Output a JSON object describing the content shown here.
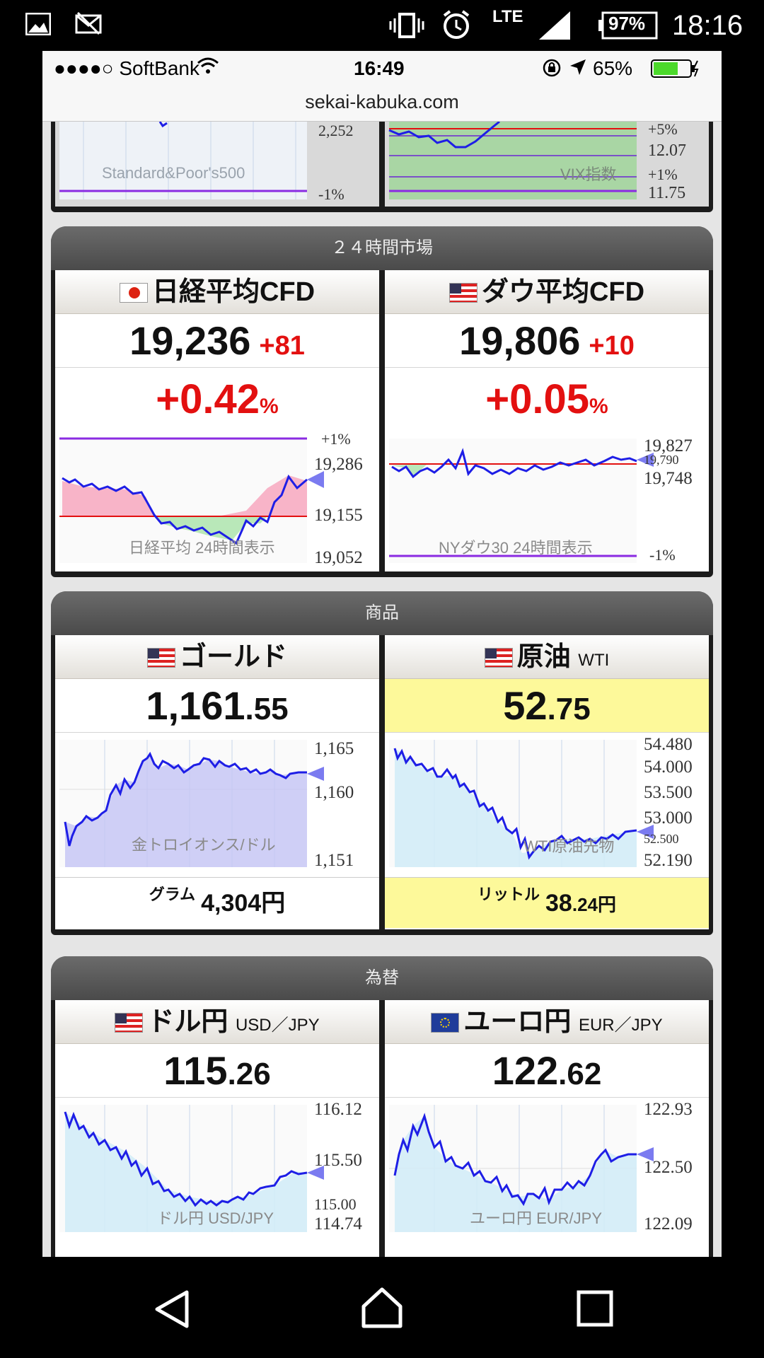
{
  "android_status": {
    "lte": "LTE",
    "battery": "97%",
    "time": "18:16"
  },
  "ios_status": {
    "carrier": "●●●●○ SoftBank",
    "time": "16:49",
    "battery": "65%"
  },
  "url": "sekai-kabuka.com",
  "top_row": {
    "sp500": {
      "watermark": "Standard&Poor's500",
      "labels": [
        "2,252",
        "-1%"
      ]
    },
    "vix": {
      "watermark": "VIX指数",
      "labels": [
        "+5%",
        "12.07",
        "+1%",
        "11.75"
      ]
    }
  },
  "sections": [
    {
      "title": "２４時間市場",
      "cards": [
        {
          "title": "日経平均CFD",
          "price": "19,236",
          "change": "+81",
          "pct": "+0.42",
          "pct_unit": "%",
          "watermark": "日経平均 24時間表示",
          "labels": [
            "+1%",
            "19,286",
            "19,155",
            "19,052"
          ]
        },
        {
          "title": "ダウ平均CFD",
          "price": "19,806",
          "change": "+10",
          "pct": "+0.05",
          "pct_unit": "%",
          "watermark": "NYダウ30 24時間表示",
          "labels": [
            "19,827",
            "19,790",
            "19,748",
            "-1%"
          ]
        }
      ]
    },
    {
      "title": "商品",
      "cards": [
        {
          "title": "ゴールド",
          "price_int": "1,161",
          "price_dec": ".55",
          "watermark": "金トロイオンス/ドル",
          "labels": [
            "1,165",
            "1,160",
            "1,151"
          ],
          "unit_label": "グラム",
          "unit_price": "4,304円"
        },
        {
          "title": "原油",
          "title_sub": "WTI",
          "price_int": "52",
          "price_dec": ".75",
          "watermark": "WTI原油先物",
          "labels": [
            "54.480",
            "54.000",
            "53.500",
            "53.000",
            "52.500",
            "52.190"
          ],
          "unit_label": "リットル",
          "unit_price_int": "38",
          "unit_price_dec": ".24円"
        }
      ]
    },
    {
      "title": "為替",
      "cards": [
        {
          "title": "ドル円",
          "title_sub": "USD／JPY",
          "price_int": "115",
          "price_dec": ".26",
          "watermark": "ドル円 USD/JPY",
          "labels": [
            "116.12",
            "115.50",
            "115.00",
            "114.74"
          ]
        },
        {
          "title": "ユーロ円",
          "title_sub": "EUR／JPY",
          "price_int": "122",
          "price_dec": ".62",
          "watermark": "ユーロ円 EUR/JPY",
          "labels": [
            "122.93",
            "122.50",
            "122.09"
          ]
        }
      ]
    }
  ],
  "colors": {
    "up": "#e31010",
    "line": "#1e1ee6",
    "highlight": "#fdf99a"
  }
}
